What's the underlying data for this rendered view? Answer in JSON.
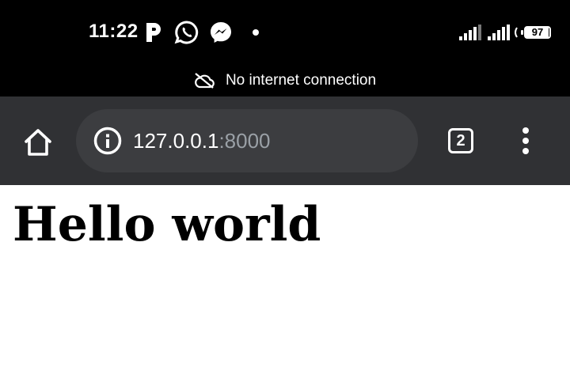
{
  "status_bar": {
    "time": "11:22",
    "notification_icons": [
      "parking-app-icon",
      "whatsapp-icon",
      "messenger-icon",
      "more-notifications-dot-icon"
    ],
    "system_icons": [
      "signal-sim1-icon",
      "signal-sim2-icon",
      "vibrate-icon",
      "battery-icon"
    ],
    "battery_percent": 97
  },
  "offline_banner": {
    "icon": "cloud-off-icon",
    "text": "No internet connection"
  },
  "browser_toolbar": {
    "url_host": "127.0.0.1",
    "url_port": ":8000",
    "tab_count": "2",
    "icons": [
      "home-icon",
      "info-icon",
      "tab-switcher-icon",
      "kebab-menu-icon"
    ]
  },
  "page": {
    "heading": "Hello world"
  },
  "colors": {
    "status_bg": "#000000",
    "toolbar_bg": "#303134",
    "omnibox_bg": "#3c3d40",
    "url_port_color": "#9aa0a6",
    "page_bg": "#ffffff"
  }
}
